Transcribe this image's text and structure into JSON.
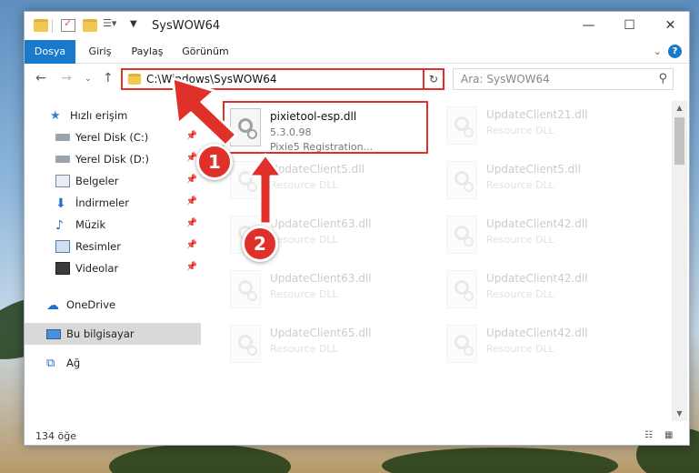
{
  "window": {
    "title": "SysWOW64",
    "controls": {
      "minimize": "—",
      "maximize": "☐",
      "close": "✕"
    }
  },
  "ribbon": {
    "tabs": [
      "Dosya",
      "Giriş",
      "Paylaş",
      "Görünüm"
    ],
    "help": "?"
  },
  "nav": {
    "address": "C:\\Windows\\SysWOW64",
    "search_placeholder": "Ara: SysWOW64"
  },
  "sidebar": {
    "items": [
      {
        "label": "Hızlı erişim",
        "icon": "star-icon"
      },
      {
        "label": "Yerel Disk (C:)",
        "icon": "drive-icon"
      },
      {
        "label": "Yerel Disk (D:)",
        "icon": "drive-icon"
      },
      {
        "label": "Belgeler",
        "icon": "documents-icon"
      },
      {
        "label": "İndirmeler",
        "icon": "download-icon"
      },
      {
        "label": "Müzik",
        "icon": "music-icon"
      },
      {
        "label": "Resimler",
        "icon": "pictures-icon"
      },
      {
        "label": "Videolar",
        "icon": "video-icon"
      },
      {
        "label": "OneDrive",
        "icon": "cloud-icon"
      },
      {
        "label": "Bu bilgisayar",
        "icon": "computer-icon"
      },
      {
        "label": "Ağ",
        "icon": "network-icon"
      }
    ]
  },
  "files": [
    {
      "name": "pixietool-esp.dll",
      "line1": "5.3.0.98",
      "line2": "Pixie5 Registration..."
    },
    {
      "name": "UpdateClient21.dll",
      "line1": "Resource DLL"
    },
    {
      "name": "UpdateClient5.dll",
      "line1": "Resource DLL"
    },
    {
      "name": "UpdateClient5.dll",
      "line1": "Resource DLL"
    },
    {
      "name": "UpdateClient63.dll",
      "line1": "Resource DLL"
    },
    {
      "name": "UpdateClient42.dll",
      "line1": "Resource DLL"
    },
    {
      "name": "UpdateClient63.dll",
      "line1": "Resource DLL"
    },
    {
      "name": "UpdateClient42.dll",
      "line1": "Resource DLL"
    },
    {
      "name": "UpdateClient65.dll",
      "line1": "Resource DLL"
    },
    {
      "name": "UpdateClient42.dll",
      "line1": "Resource DLL"
    }
  ],
  "status": {
    "count": "134 öğe"
  },
  "annotations": {
    "badge1": "1",
    "badge2": "2",
    "accent": "#e0302a"
  }
}
